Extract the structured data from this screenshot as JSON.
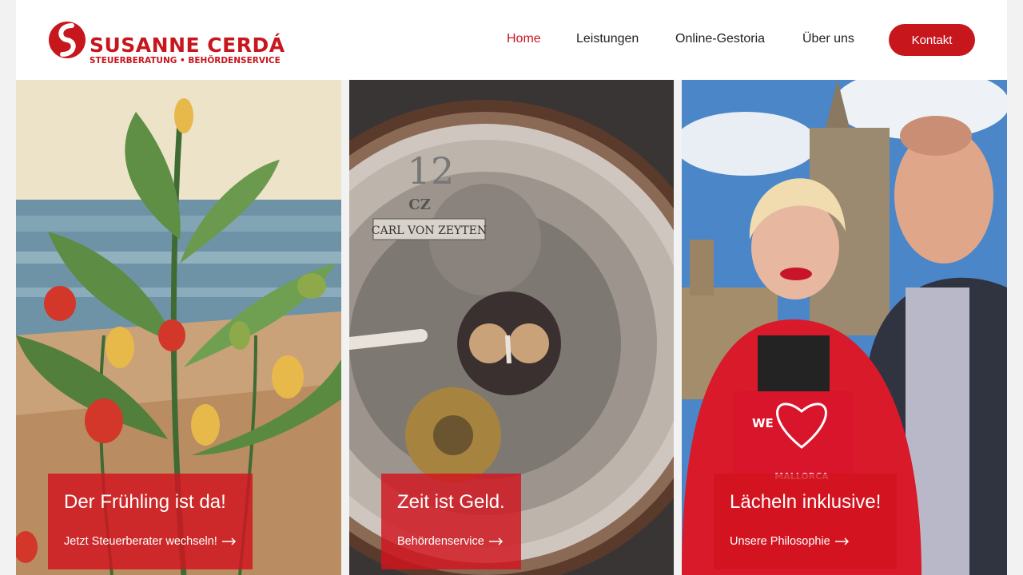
{
  "brand": {
    "name": "SUSANNE CERDÁ",
    "tagline": "STEUERBERATUNG • BEHÖRDENSERVICE",
    "color": "#c8161d"
  },
  "nav": {
    "items": [
      {
        "label": "Home",
        "active": true
      },
      {
        "label": "Leistungen",
        "active": false
      },
      {
        "label": "Online-Gestoria",
        "active": false
      },
      {
        "label": "Über uns",
        "active": false
      }
    ],
    "cta": "Kontakt"
  },
  "cards": [
    {
      "title": "Der Frühling ist da!",
      "link": "Jetzt Steuerberater wechseln!",
      "icon": "arrow-right-icon"
    },
    {
      "title": "Zeit ist Geld.",
      "link": "Behördenservice",
      "icon": "arrow-right-icon"
    },
    {
      "title": "Lächeln inklusive!",
      "link": "Unsere Philosophie",
      "icon": "arrow-right-icon"
    }
  ],
  "watch": {
    "brand_text": "CARL VON ZEYTEN",
    "monogram": "CZ",
    "numeral": "12"
  },
  "mallorca_sign": {
    "we": "WE",
    "place": "MALLORCA"
  }
}
